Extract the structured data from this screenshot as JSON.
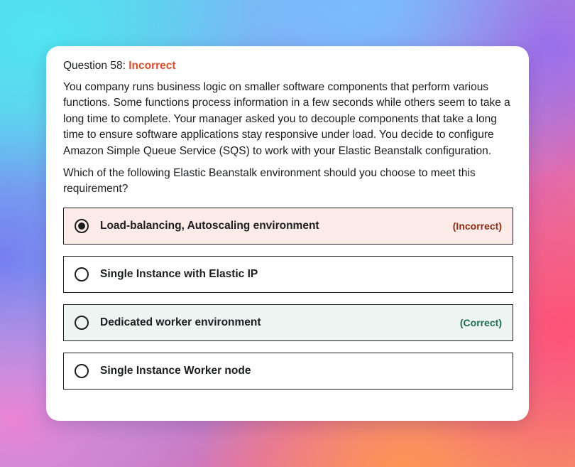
{
  "question": {
    "label": "Question 58:",
    "status": "Incorrect",
    "text": "You company runs business logic on smaller software components that perform various functions. Some functions process information in a few seconds while others seem to take a long time to complete. Your manager asked you to decouple components that take a long time to ensure software applications stay responsive under load. You decide to configure Amazon Simple Queue Service (SQS) to work with your Elastic Beanstalk configuration.",
    "prompt": "Which of the following Elastic Beanstalk environment should you choose to meet this requirement?"
  },
  "options": [
    {
      "label": "Load-balancing, Autoscaling environment",
      "tag": "(Incorrect)",
      "selected": true
    },
    {
      "label": "Single Instance with Elastic IP",
      "tag": "",
      "selected": false
    },
    {
      "label": "Dedicated worker environment",
      "tag": "(Correct)",
      "selected": false
    },
    {
      "label": "Single Instance Worker node",
      "tag": "",
      "selected": false
    }
  ],
  "colors": {
    "incorrect_accent": "#d6502b",
    "incorrect_bg": "#fcebe8",
    "incorrect_tag": "#8a2e17",
    "correct_bg": "#eef4f2",
    "correct_tag": "#1e6b52"
  }
}
